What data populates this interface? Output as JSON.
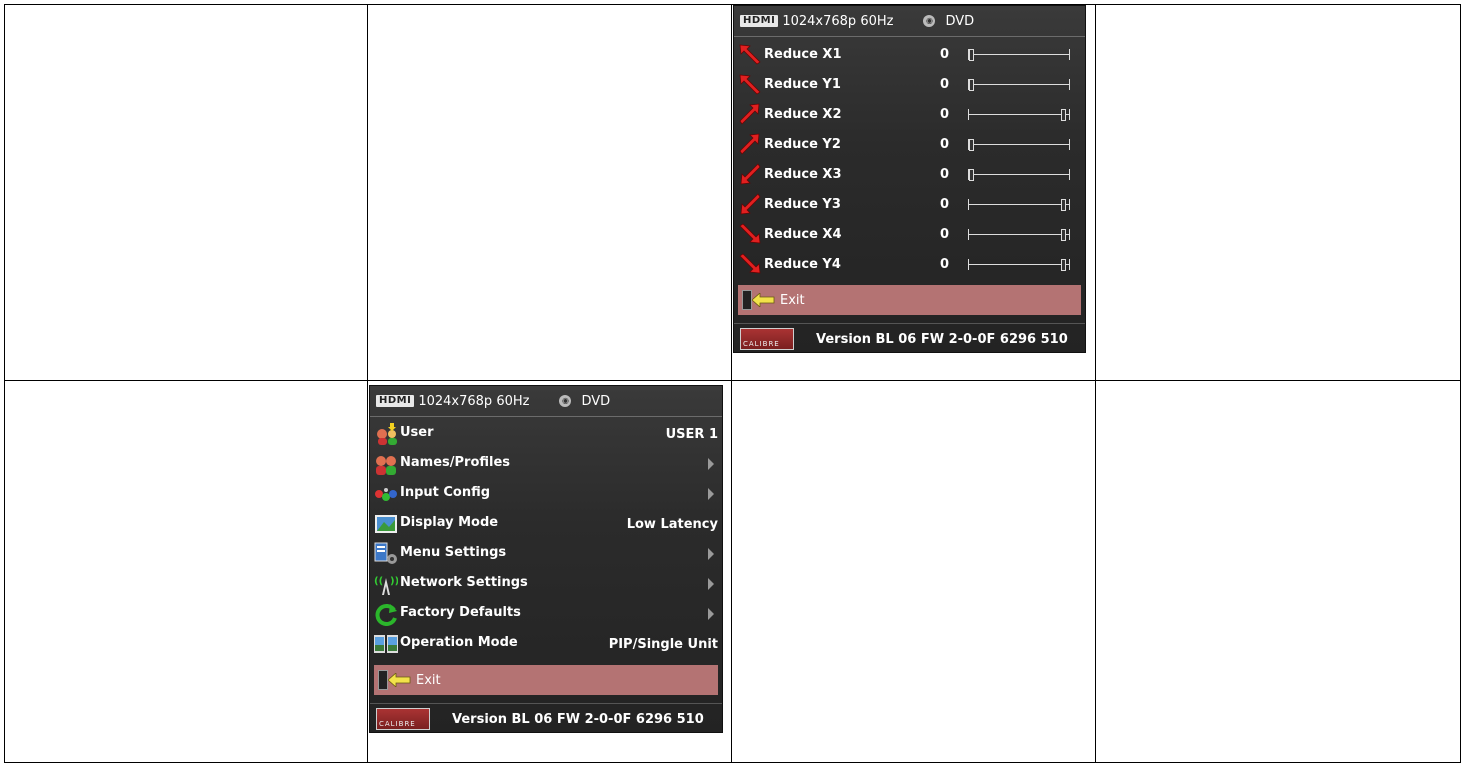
{
  "panel_top": {
    "header": {
      "hdmi_logo": "HDMI",
      "resolution": "1024x768p 60Hz",
      "source_icon": "source-disc-icon",
      "source": "DVD"
    },
    "rows": [
      {
        "label": "Reduce X1",
        "value": "0",
        "arrow": "arrow-up-left-icon",
        "slider_level": 0.0
      },
      {
        "label": "Reduce Y1",
        "value": "0",
        "arrow": "arrow-up-left-icon",
        "slider_level": 0.0
      },
      {
        "label": "Reduce X2",
        "value": "0",
        "arrow": "arrow-up-right-icon",
        "slider_level": 1.0
      },
      {
        "label": "Reduce Y2",
        "value": "0",
        "arrow": "arrow-up-right-icon",
        "slider_level": 0.0
      },
      {
        "label": "Reduce X3",
        "value": "0",
        "arrow": "arrow-down-left-icon",
        "slider_level": 0.0
      },
      {
        "label": "Reduce Y3",
        "value": "0",
        "arrow": "arrow-down-left-icon",
        "slider_level": 1.0
      },
      {
        "label": "Reduce X4",
        "value": "0",
        "arrow": "arrow-down-right-icon",
        "slider_level": 1.0
      },
      {
        "label": "Reduce Y4",
        "value": "0",
        "arrow": "arrow-down-right-icon",
        "slider_level": 1.0
      }
    ],
    "exit_label": "Exit",
    "footer": {
      "logo_text": "CALIBRE",
      "version": "Version BL 06 FW 2-0-0F  6296 510"
    }
  },
  "panel_bottom": {
    "header": {
      "hdmi_logo": "HDMI",
      "resolution": "1024x768p 60Hz",
      "source_icon": "source-disc-icon",
      "source": "DVD"
    },
    "rows": [
      {
        "label": "User",
        "value": "USER 1",
        "icon": "user-icon",
        "submenu": false
      },
      {
        "label": "Names/Profiles",
        "value": "",
        "icon": "users-icon",
        "submenu": true
      },
      {
        "label": "Input Config",
        "value": "",
        "icon": "input-config-icon",
        "submenu": true
      },
      {
        "label": "Display Mode",
        "value": "Low Latency",
        "icon": "display-mode-icon",
        "submenu": false
      },
      {
        "label": "Menu Settings",
        "value": "",
        "icon": "menu-settings-icon",
        "submenu": true
      },
      {
        "label": "Network Settings",
        "value": "",
        "icon": "network-icon",
        "submenu": true
      },
      {
        "label": "Factory Defaults",
        "value": "",
        "icon": "factory-reset-icon",
        "submenu": true
      },
      {
        "label": "Operation Mode",
        "value": "PIP/Single Unit",
        "icon": "operation-mode-icon",
        "submenu": false
      }
    ],
    "exit_label": "Exit",
    "footer": {
      "logo_text": "CALIBRE",
      "version": "Version BL 06 FW 2-0-0F  6296 510"
    }
  },
  "colors": {
    "exit_bar": "#b47373",
    "arrow": "#e02020",
    "panel_bg": "#2b2b2b"
  }
}
